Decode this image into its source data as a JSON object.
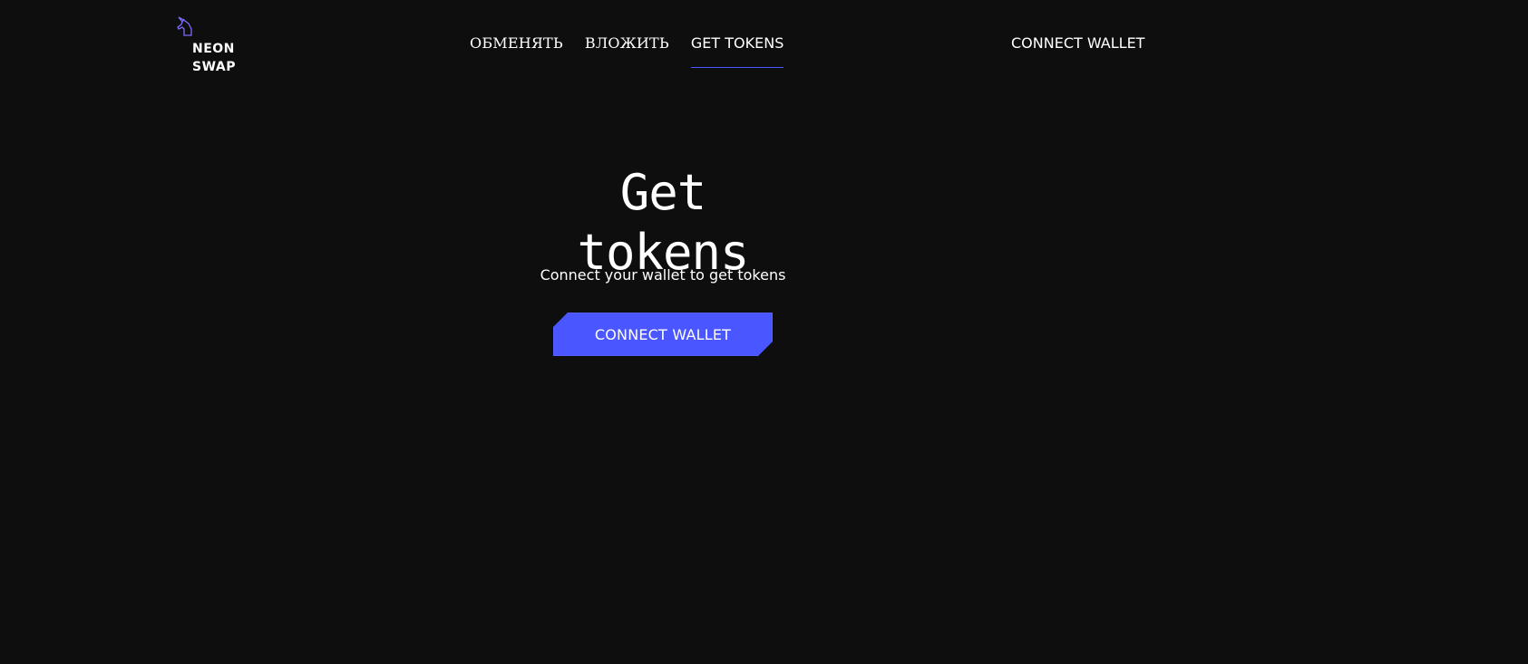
{
  "brand": {
    "name_line1": "NEON",
    "name_line2": "SWAP",
    "logo_icon": "unicorn-icon",
    "logo_color": "#7b6cff"
  },
  "nav": {
    "items": [
      {
        "label": "ОБМЕНЯТЬ",
        "active": false
      },
      {
        "label": "ВЛОЖИТЬ",
        "active": false
      },
      {
        "label": "GET TOKENS",
        "active": true
      }
    ]
  },
  "header": {
    "connect_label": "CONNECT WALLET"
  },
  "main": {
    "title": "Get tokens",
    "subtitle": "Connect your wallet to get tokens",
    "button_label": "CONNECT WALLET"
  },
  "colors": {
    "background": "#0e0e0e",
    "accent": "#4a56ff",
    "text": "#ffffff"
  }
}
